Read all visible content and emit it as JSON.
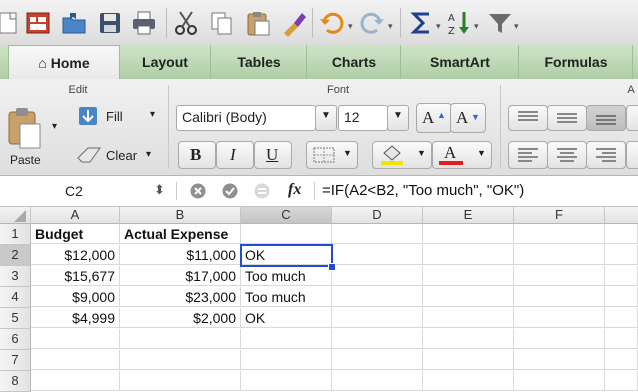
{
  "ribbon_tabs": [
    "Home",
    "Layout",
    "Tables",
    "Charts",
    "SmartArt",
    "Formulas"
  ],
  "groups": {
    "edit": "Edit",
    "font": "Font",
    "alignment": "A"
  },
  "edit": {
    "paste": "Paste",
    "fill": "Fill",
    "clear": "Clear"
  },
  "font": {
    "name": "Calibri (Body)",
    "size": "12",
    "bold": "B",
    "italic": "I",
    "underline": "U",
    "grow": "A",
    "shrink": "A",
    "color_letter": "A"
  },
  "formula_bar": {
    "cell_ref": "C2",
    "fx": "fx",
    "formula": "=IF(A2<B2, \"Too much\", \"OK\")"
  },
  "columns": [
    "A",
    "B",
    "C",
    "D",
    "E",
    "F"
  ],
  "rows": [
    "1",
    "2",
    "3",
    "4",
    "5",
    "6",
    "7",
    "8"
  ],
  "sheet": {
    "header": {
      "a": "Budget",
      "b": "Actual Expense"
    },
    "data": [
      {
        "a": "$12,000",
        "b": "$11,000",
        "c": "OK"
      },
      {
        "a": "$15,677",
        "b": "$17,000",
        "c": "Too much"
      },
      {
        "a": "$9,000",
        "b": "$23,000",
        "c": "Too much"
      },
      {
        "a": "$4,999",
        "b": "$2,000",
        "c": "OK"
      }
    ]
  },
  "colors": {
    "selection": "#1f4fd0",
    "tab_bar": "#aecda5",
    "font_color_bar": "#e02020",
    "highlight_bar": "#f2e600"
  }
}
